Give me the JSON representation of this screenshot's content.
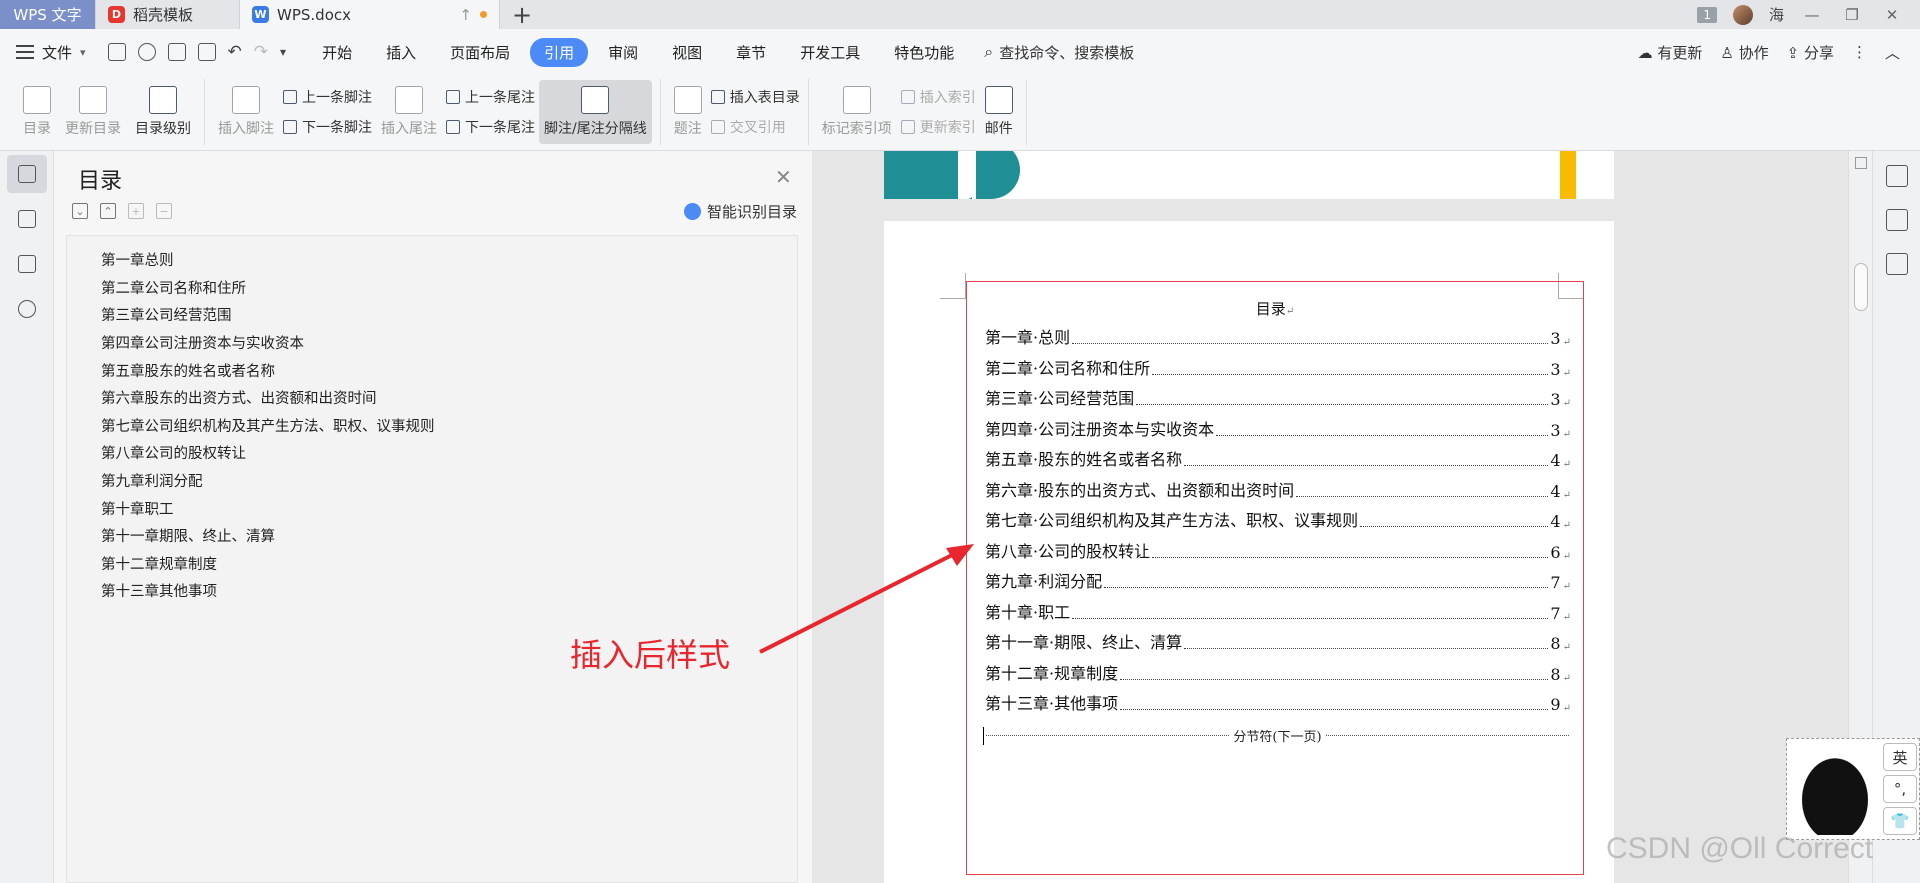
{
  "tabs": {
    "app": "WPS 文字",
    "template": "稻壳模板",
    "doc": "WPS.docx",
    "new_tab": "+"
  },
  "titlebar": {
    "window_count": "1",
    "user": "海"
  },
  "menu": {
    "file": "文件",
    "tabs": [
      "开始",
      "插入",
      "页面布局",
      "引用",
      "审阅",
      "视图",
      "章节",
      "开发工具",
      "特色功能"
    ],
    "active_tab": "引用",
    "search": "查找命令、搜索模板",
    "update": "有更新",
    "collab": "协作",
    "share": "分享"
  },
  "ribbon": {
    "toc": "目录",
    "update_toc": "更新目录",
    "toc_level": "目录级别",
    "insert_footnote": "插入脚注",
    "prev_footnote": "上一条脚注",
    "next_footnote": "下一条脚注",
    "insert_endnote": "插入尾注",
    "prev_endnote": "上一条尾注",
    "next_endnote": "下一条尾注",
    "separator": "脚注/尾注分隔线",
    "caption": "题注",
    "insert_table_toc": "插入表目录",
    "cross_ref": "交叉引用",
    "mark_index": "标记索引项",
    "insert_index": "插入索引",
    "update_index": "更新索引",
    "mail": "邮件"
  },
  "toc_pane": {
    "title": "目录",
    "smart_detect": "智能识别目录",
    "items": [
      "第一章总则",
      "第二章公司名称和住所",
      "第三章公司经营范围",
      "第四章公司注册资本与实收资本",
      "第五章股东的姓名或者名称",
      "第六章股东的出资方式、出资额和出资时间",
      "第七章公司组织机构及其产生方法、职权、议事规则",
      "第八章公司的股权转让",
      "第九章利润分配",
      "第十章职工",
      "第十一章期限、终止、清算",
      "第十二章规章制度",
      "第十三章其他事项"
    ]
  },
  "document": {
    "toc_heading": "目录",
    "entries": [
      {
        "title": "第一章·总则",
        "page": "3"
      },
      {
        "title": "第二章·公司名称和住所",
        "page": "3"
      },
      {
        "title": "第三章·公司经营范围",
        "page": "3"
      },
      {
        "title": "第四章·公司注册资本与实收资本",
        "page": "3"
      },
      {
        "title": "第五章·股东的姓名或者名称",
        "page": "4"
      },
      {
        "title": "第六章·股东的出资方式、出资额和出资时间",
        "page": "4"
      },
      {
        "title": "第七章·公司组织机构及其产生方法、职权、议事规则",
        "page": "4"
      },
      {
        "title": "第八章·公司的股权转让",
        "page": "6"
      },
      {
        "title": "第九章·利润分配",
        "page": "7"
      },
      {
        "title": "第十章·职工",
        "page": "7"
      },
      {
        "title": "第十一章·期限、终止、清算",
        "page": "8"
      },
      {
        "title": "第十二章·规章制度",
        "page": "8"
      },
      {
        "title": "第十三章·其他事项",
        "page": "9"
      }
    ],
    "section_break": "分节符(下一页)"
  },
  "annotation": "插入后样式",
  "ime": {
    "lang": "英",
    "punct": "°,",
    "skin": "👕"
  },
  "watermark": "CSDN @Oll Correct",
  "colors": {
    "accent": "#4c8bf5",
    "annotation": "#e8262d",
    "toc_field_border": "#e3434a",
    "teal": "#1f8f95",
    "yellow": "#f7bc00"
  }
}
